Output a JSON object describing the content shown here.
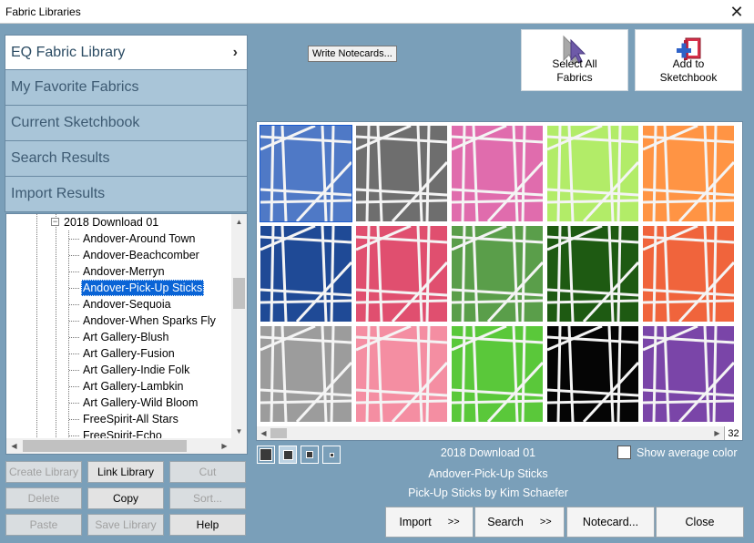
{
  "window": {
    "title": "Fabric Libraries",
    "close_label": "✕"
  },
  "library_nav": [
    {
      "label": "EQ Fabric Library"
    },
    {
      "label": "My Favorite Fabrics"
    },
    {
      "label": "Current Sketchbook"
    },
    {
      "label": "Search Results"
    },
    {
      "label": "Import Results"
    }
  ],
  "library_nav_chevron": "›",
  "tree": {
    "parent": {
      "label": "2018 Download 01",
      "expander": "−"
    },
    "children": [
      "Andover-Around Town",
      "Andover-Beachcomber",
      "Andover-Merryn",
      "Andover-Pick-Up Sticks",
      "Andover-Sequoia",
      "Andover-When Sparks Fly",
      "Art Gallery-Blush",
      "Art Gallery-Fusion",
      "Art Gallery-Indie Folk",
      "Art Gallery-Lambkin",
      "Art Gallery-Wild Bloom",
      "FreeSpirit-All Stars",
      "FreeSpirit-Echo"
    ],
    "selected_index": 3
  },
  "left_buttons": [
    {
      "label": "Create Library",
      "enabled": false
    },
    {
      "label": "Link Library",
      "enabled": true
    },
    {
      "label": "Cut",
      "enabled": false
    },
    {
      "label": "Delete",
      "enabled": false
    },
    {
      "label": "Copy",
      "enabled": true
    },
    {
      "label": "Sort...",
      "enabled": false
    },
    {
      "label": "Paste",
      "enabled": false
    },
    {
      "label": "Save Library",
      "enabled": false
    },
    {
      "label": "Help",
      "enabled": true
    }
  ],
  "toolbar": {
    "write_notecards": "Write Notecards...",
    "select_all_line1": "Select All",
    "select_all_line2": "Fabrics",
    "add_line1": "Add to",
    "add_line2": "Sketchbook"
  },
  "swatches": {
    "colors": [
      "#4f79c6",
      "#6e6e6e",
      "#e06cad",
      "#b2ec68",
      "#ff9444",
      "#1f4a96",
      "#e04f6f",
      "#5a9e4a",
      "#1e5a12",
      "#f0643c",
      "#9c9c9c",
      "#f48ea2",
      "#5ac83a",
      "#050505",
      "#7a45a8"
    ],
    "selected_index": 0,
    "count": "32"
  },
  "info": {
    "collection": "2018 Download 01",
    "fabric": "Andover-Pick-Up Sticks",
    "designer": "Pick-Up Sticks by Kim Schaefer"
  },
  "avg_color_label": "Show average color",
  "actions": {
    "import": "Import",
    "search": "Search",
    "arrows": ">>",
    "notecard": "Notecard...",
    "close": "Close"
  },
  "icons": {
    "select_all": "cursor-pointer-icon",
    "add_sketchbook": "sketchbook-add-icon"
  }
}
